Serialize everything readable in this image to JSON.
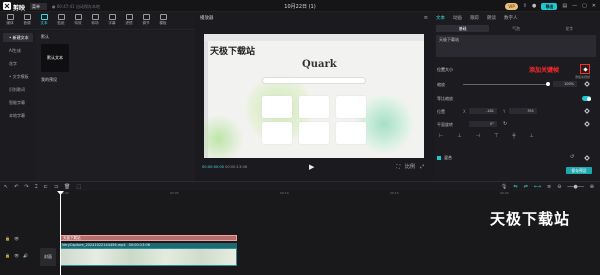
{
  "titlebar": {
    "app_name": "剪映",
    "menu": "菜单",
    "save_info": "● 00:47:41 自动保存本地",
    "title": "10月22日 (1)",
    "vip": "VIP",
    "export": "导出"
  },
  "media_tabs": [
    "媒体",
    "音频",
    "文本",
    "贴纸",
    "特效",
    "转场",
    "字幕",
    "滤镜",
    "调节",
    "模板"
  ],
  "side_nav": [
    "• 新建文本",
    "AI生成",
    "花字",
    "• 文字模板",
    "识别歌词",
    "智能字幕",
    "本地字幕"
  ],
  "text_pane": {
    "default_label": "默认",
    "card_label": "默认文本",
    "recent_label": "我的预设"
  },
  "player": {
    "header": "播放器",
    "current_time": "00:00:00:00",
    "total_time": "00:00:13:06",
    "watermark": "天极下载站",
    "quark_logo": "Quark",
    "ratio_label": "比例"
  },
  "inspector": {
    "tabs": [
      "文本",
      "动画",
      "跟踪",
      "朗读",
      "数字人"
    ],
    "subtabs": [
      "基础",
      "气泡",
      "花字"
    ],
    "text_value": "天极下载站",
    "position_size_label": "位置大小",
    "add_keyframe_annotation": "添加关键帧",
    "keyframe_tooltip": "添加关键帧",
    "scale_label": "缩放",
    "scale_value": "100%",
    "uniform_scale_label": "等比缩放",
    "position_label": "位置",
    "pos_x_label": "X",
    "pos_x": "-181",
    "pos_y_label": "Y",
    "pos_y": "351",
    "rotation_label": "平面旋转",
    "rotation_value": "0°",
    "blend_label": "混合",
    "save_preset": "保存预设"
  },
  "timeline": {
    "ticks": [
      "00:00",
      "00:05",
      "00:10",
      "00:15",
      "00:20"
    ],
    "text_clip": "天极下载站",
    "video_clip_name": "VeryCapture_20241022144456.mp4",
    "video_clip_duration": "00:00:13:06",
    "cover_label": "封面",
    "watermark": "天极下载站"
  }
}
